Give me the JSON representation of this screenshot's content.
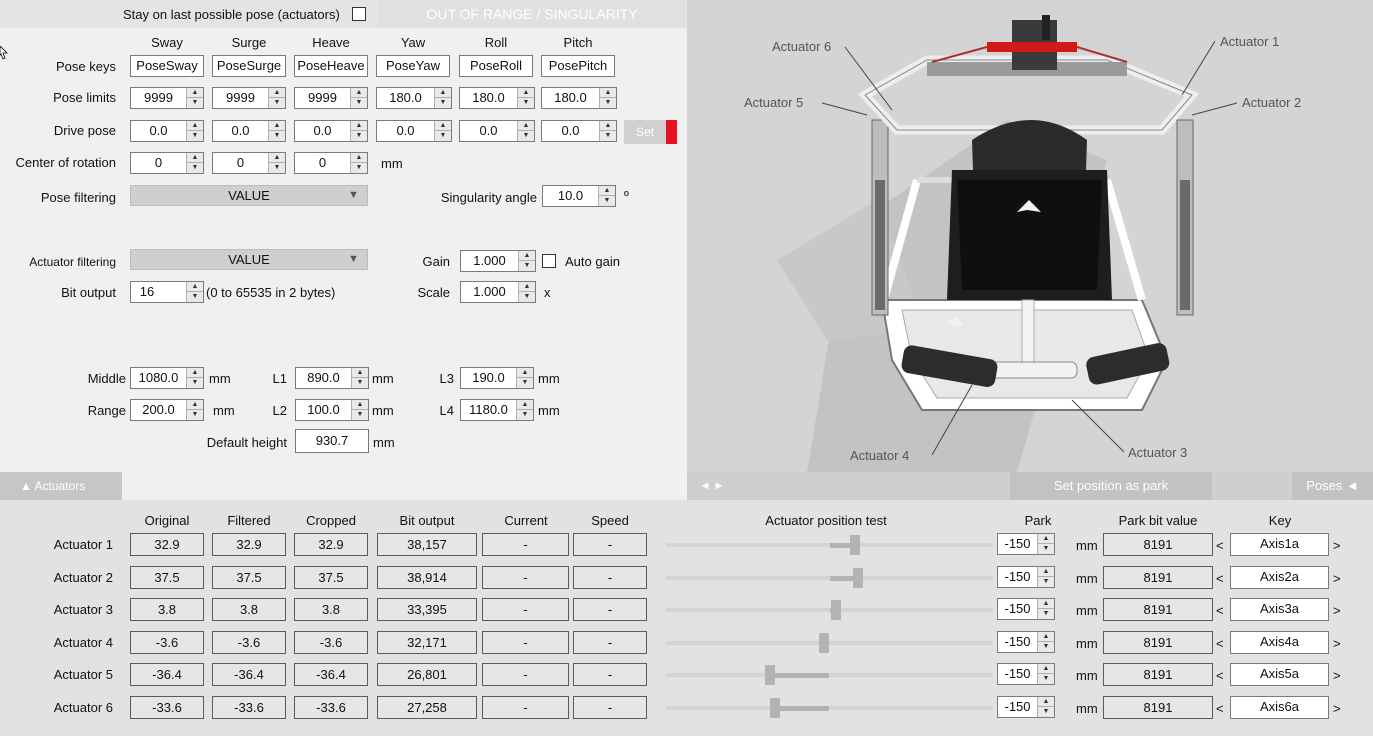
{
  "top": {
    "stay_label": "Stay on last possible pose (actuators)",
    "warning": "OUT OF RANGE / SINGULARITY"
  },
  "pose": {
    "columns": [
      "Sway",
      "Surge",
      "Heave",
      "Yaw",
      "Roll",
      "Pitch"
    ],
    "keys_label": "Pose keys",
    "keys": [
      "PoseSway",
      "PoseSurge",
      "PoseHeave",
      "PoseYaw",
      "PoseRoll",
      "PosePitch"
    ],
    "limits_label": "Pose limits",
    "limits": [
      "9999",
      "9999",
      "9999",
      "180.0",
      "180.0",
      "180.0"
    ],
    "drive_label": "Drive pose",
    "drive": [
      "0.0",
      "0.0",
      "0.0",
      "0.0",
      "0.0",
      "0.0"
    ],
    "set_label": "Set",
    "cor_label": "Center of rotation",
    "cor": [
      "0",
      "0",
      "0"
    ],
    "cor_unit": "mm"
  },
  "filters": {
    "pose_filtering_label": "Pose filtering",
    "pose_filtering_value": "VALUE",
    "singularity_label": "Singularity angle",
    "singularity_value": "10.0",
    "singularity_unit": "º",
    "actuator_filtering_label": "Actuator filtering",
    "actuator_filtering_value": "VALUE",
    "gain_label": "Gain",
    "gain_value": "1.000",
    "auto_gain_label": "Auto gain",
    "bit_output_label": "Bit output",
    "bit_output_value": "16",
    "bit_output_note": "(0 to 65535 in 2 bytes)",
    "scale_label": "Scale",
    "scale_value": "1.000",
    "scale_unit": "x"
  },
  "geometry": {
    "middle_label": "Middle",
    "middle": "1080.0",
    "range_label": "Range",
    "range": "200.0",
    "l1_label": "L1",
    "l1": "890.0",
    "l2_label": "L2",
    "l2": "100.0",
    "l3_label": "L3",
    "l3": "190.0",
    "l4_label": "L4",
    "l4": "1180.0",
    "unit": "mm",
    "default_height_label": "Default height",
    "default_height": "930.7"
  },
  "viewer": {
    "labels": [
      "Actuator 1",
      "Actuator 2",
      "Actuator 3",
      "Actuator 4",
      "Actuator 5",
      "Actuator 6"
    ],
    "nav_arrows": "◄ ►",
    "set_park": "Set position as park",
    "poses_tab": "Poses ◄"
  },
  "actuators_tab": "▲ Actuators",
  "table": {
    "headers": {
      "original": "Original",
      "filtered": "Filtered",
      "cropped": "Cropped",
      "bit_output": "Bit output",
      "current": "Current",
      "speed": "Speed",
      "position_test": "Actuator position test",
      "park": "Park",
      "park_bit": "Park bit value",
      "key": "Key"
    },
    "park_unit": "mm",
    "rows": [
      {
        "name": "Actuator 1",
        "original": "32.9",
        "filtered": "32.9",
        "cropped": "32.9",
        "bit": "38,157",
        "current": "-",
        "speed": "-",
        "position": 0.578,
        "park": "-150",
        "park_bit": "8191",
        "key": "Axis1a"
      },
      {
        "name": "Actuator 2",
        "original": "37.5",
        "filtered": "37.5",
        "cropped": "37.5",
        "bit": "38,914",
        "current": "-",
        "speed": "-",
        "position": 0.588,
        "park": "-150",
        "park_bit": "8191",
        "key": "Axis2a"
      },
      {
        "name": "Actuator 3",
        "original": "3.8",
        "filtered": "3.8",
        "cropped": "3.8",
        "bit": "33,395",
        "current": "-",
        "speed": "-",
        "position": 0.519,
        "park": "-150",
        "park_bit": "8191",
        "key": "Axis3a"
      },
      {
        "name": "Actuator 4",
        "original": "-3.6",
        "filtered": "-3.6",
        "cropped": "-3.6",
        "bit": "32,171",
        "current": "-",
        "speed": "-",
        "position": 0.482,
        "park": "-150",
        "park_bit": "8191",
        "key": "Axis4a"
      },
      {
        "name": "Actuator 5",
        "original": "-36.4",
        "filtered": "-36.4",
        "cropped": "-36.4",
        "bit": "26,801",
        "current": "-",
        "speed": "-",
        "position": 0.318,
        "park": "-150",
        "park_bit": "8191",
        "key": "Axis5a"
      },
      {
        "name": "Actuator 6",
        "original": "-33.6",
        "filtered": "-33.6",
        "cropped": "-33.6",
        "bit": "27,258",
        "current": "-",
        "speed": "-",
        "position": 0.332,
        "park": "-150",
        "park_bit": "8191",
        "key": "Axis6a"
      }
    ]
  },
  "colors": {
    "warning_bg": "#e3e3e3",
    "warning_text": "#ffffff",
    "viewer_bg": "#d4d4d4",
    "bar_bg": "#cfcfcf",
    "set_button_bg": "#d0d0d0",
    "alert_red": "#e81123",
    "tab_bg": "#c0c0c0",
    "bottom_bg": "#e2e2e2"
  }
}
